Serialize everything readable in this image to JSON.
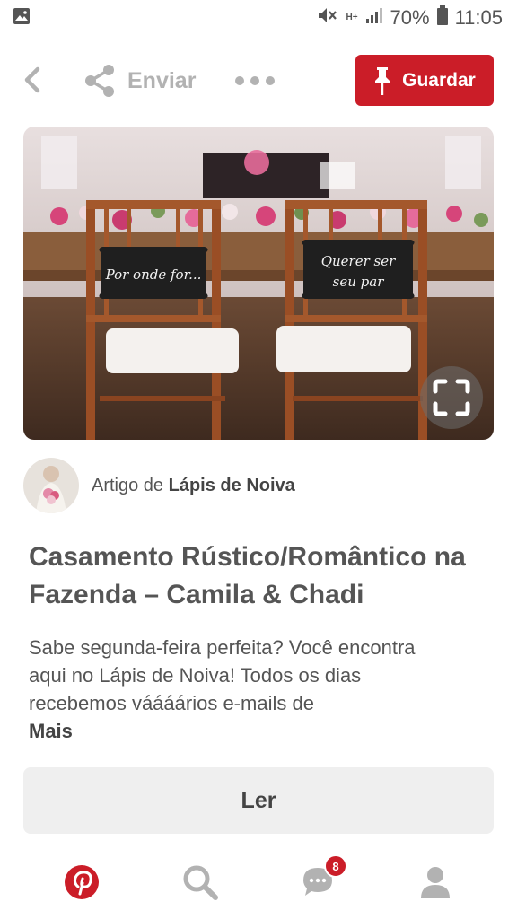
{
  "status_bar": {
    "signal_text": "H+",
    "battery": "70%",
    "time": "11:05",
    "icons": [
      "image-icon",
      "mute-icon",
      "signal-icon",
      "battery-icon"
    ]
  },
  "toolbar": {
    "share_label": "Enviar",
    "save_label": "Guardar",
    "accent_color": "#cb1d28"
  },
  "hero": {
    "sign_left": "Por onde for...",
    "sign_right_line1": "Querer ser",
    "sign_right_line2": "seu par"
  },
  "author": {
    "prefix": "Artigo de",
    "name": "Lápis de Noiva"
  },
  "article": {
    "title": "Casamento Rústico/Romântico na Fazenda – Camila & Chadi",
    "description": "Sabe segunda-feira perfeita? Você encontra aqui no Lápis de Noiva! Todos os dias recebemos váááários e-mails de",
    "more_label": "Mais"
  },
  "read_button": {
    "label": "Ler"
  },
  "bottom_nav": {
    "items": [
      "home-icon",
      "search-icon",
      "messages-icon",
      "profile-icon"
    ],
    "messages_badge": "8"
  }
}
